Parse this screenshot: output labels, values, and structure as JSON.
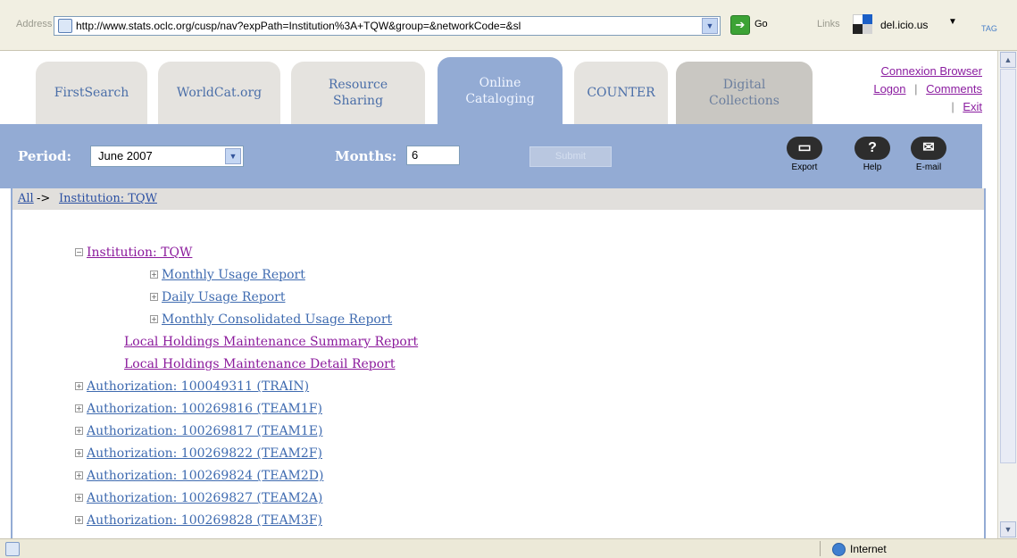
{
  "browser": {
    "address_label": "Address",
    "url": "http://www.stats.oclc.org/cusp/nav?expPath=Institution%3A+TQW&group=&networkCode=&sl",
    "go_label": "Go",
    "links_label": "Links",
    "bookmark_label": "del.icio.us",
    "tag_label": "TAG"
  },
  "tabs": [
    {
      "label": "FirstSearch"
    },
    {
      "label": "WorldCat.org"
    },
    {
      "label": "Resource Sharing"
    },
    {
      "label": "Online Cataloging"
    },
    {
      "label": "COUNTER"
    },
    {
      "label": "Digital Collections"
    }
  ],
  "top_links": {
    "connexion": "Connexion Browser",
    "logon": "Logon",
    "separator": "|",
    "comments": "Comments",
    "exit": "Exit"
  },
  "toolbar": {
    "period_label": "Period:",
    "period_value": "June 2007",
    "months_label": "Months:",
    "months_value": "6",
    "submit_label": "Submit",
    "export_label": "Export",
    "help_label": "Help",
    "email_label": "E-mail"
  },
  "breadcrumb": {
    "all": "All",
    "arrow": "->",
    "current": "Institution: TQW"
  },
  "tree": {
    "root": "Institution: TQW",
    "reports": [
      "Monthly Usage Report",
      "Daily Usage Report",
      "Monthly Consolidated Usage Report",
      "Local Holdings Maintenance Summary Report",
      "Local Holdings Maintenance Detail Report"
    ],
    "authorizations": [
      "Authorization: 100049311 (TRAIN)",
      "Authorization: 100269816 (TEAM1F)",
      "Authorization: 100269817 (TEAM1E)",
      "Authorization: 100269822 (TEAM2F)",
      "Authorization: 100269824 (TEAM2D)",
      "Authorization: 100269827 (TEAM2A)",
      "Authorization: 100269828 (TEAM3F)"
    ]
  },
  "status": {
    "zone": "Internet"
  }
}
